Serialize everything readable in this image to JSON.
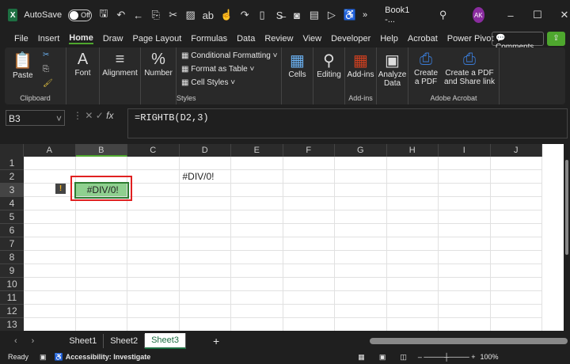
{
  "title": {
    "autosave": "AutoSave",
    "toggle": "Off",
    "book": "Book1 -...",
    "avatar": "AK",
    "more": "»"
  },
  "menu": [
    "File",
    "Insert",
    "Home",
    "Draw",
    "Page Layout",
    "Formulas",
    "Data",
    "Review",
    "View",
    "Developer",
    "Help",
    "Acrobat",
    "Power Pivot"
  ],
  "comments": "Comments",
  "ribbon": {
    "paste": "Paste",
    "clipboard": "Clipboard",
    "font": "Font",
    "alignment": "Alignment",
    "number": "Number",
    "cond": "Conditional Formatting",
    "fmt_table": "Format as Table",
    "cell_styles": "Cell Styles",
    "styles": "Styles",
    "cells": "Cells",
    "editing": "Editing",
    "addins": "Add-ins",
    "addins_grp": "Add-ins",
    "analyze": "Analyze Data",
    "create_pdf": "Create a PDF",
    "share_pdf": "Create a PDF and Share link",
    "acrobat": "Adobe Acrobat"
  },
  "namebox": "B3",
  "fx": "fx",
  "formula": "=RIGHTB(D2,3)",
  "columns": [
    "A",
    "B",
    "C",
    "D",
    "E",
    "F",
    "G",
    "H",
    "I",
    "J"
  ],
  "rows": [
    "1",
    "2",
    "3",
    "4",
    "5",
    "6",
    "7",
    "8",
    "9",
    "10",
    "11",
    "12",
    "13"
  ],
  "cells": {
    "D2": "#DIV/0!",
    "B3": "#DIV/0!"
  },
  "sheets": [
    "Sheet1",
    "Sheet2",
    "Sheet3"
  ],
  "active_sheet": "Sheet3",
  "status": {
    "ready": "Ready",
    "accessibility": "Accessibility: Investigate",
    "zoom": "100%"
  }
}
